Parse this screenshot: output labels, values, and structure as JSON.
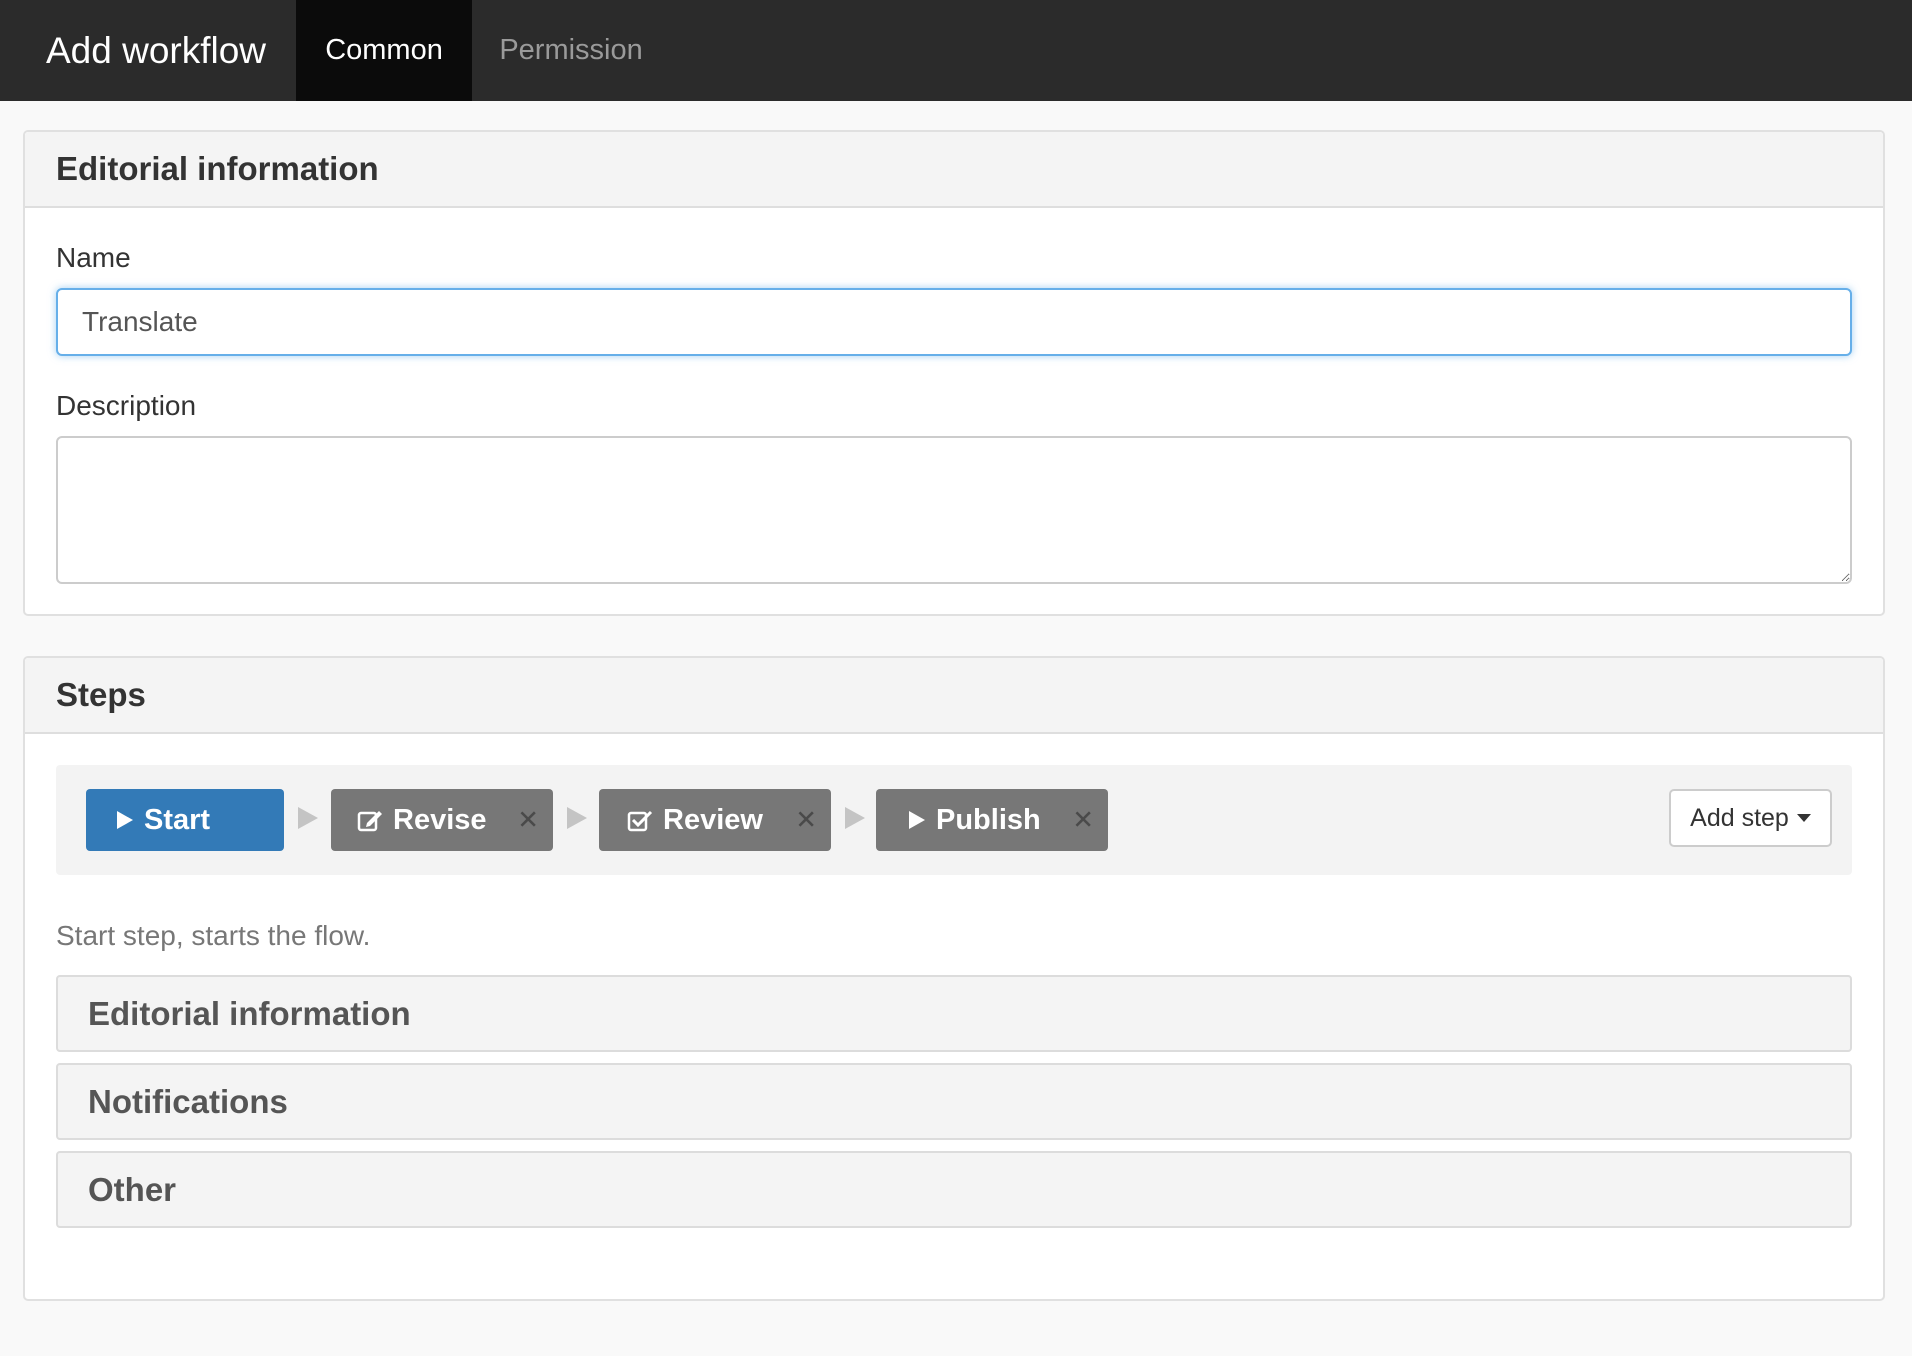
{
  "header": {
    "title": "Add workflow",
    "tabs": [
      {
        "label": "Common",
        "active": true
      },
      {
        "label": "Permission",
        "active": false
      }
    ]
  },
  "editorial": {
    "heading": "Editorial information",
    "name_label": "Name",
    "name_value": "Translate",
    "description_label": "Description",
    "description_value": ""
  },
  "steps": {
    "heading": "Steps",
    "items": [
      {
        "label": "Start",
        "icon": "play-icon",
        "removable": false,
        "color": "#337ab7"
      },
      {
        "label": "Revise",
        "icon": "edit-icon",
        "removable": true,
        "color": "#777777"
      },
      {
        "label": "Review",
        "icon": "check-square-icon",
        "removable": true,
        "color": "#777777"
      },
      {
        "label": "Publish",
        "icon": "play-icon",
        "removable": true,
        "color": "#777777"
      }
    ],
    "add_step_label": "Add step",
    "help_text": "Start step, starts the flow.",
    "sections": [
      "Editorial information",
      "Notifications",
      "Other"
    ]
  }
}
